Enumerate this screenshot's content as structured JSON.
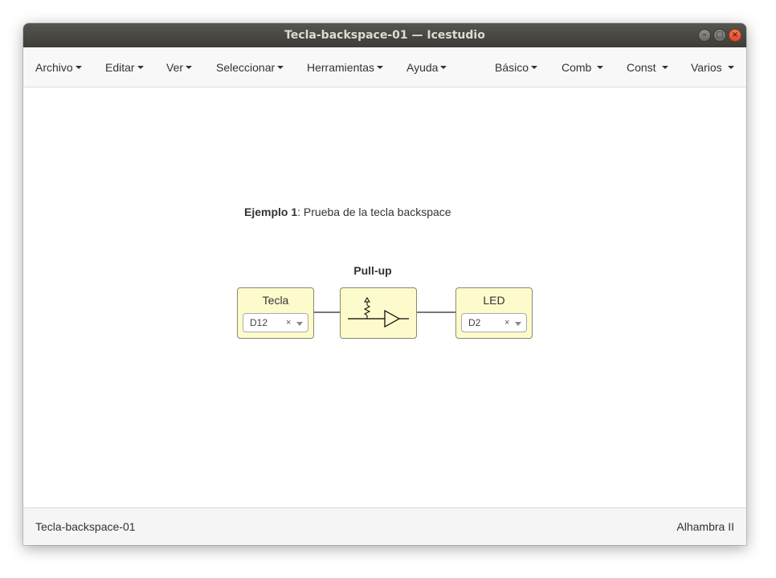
{
  "window": {
    "title": "Tecla-backspace-01 — Icestudio",
    "controls": {
      "minimize_icon": "minimize-icon",
      "maximize_icon": "maximize-icon",
      "close_icon": "close-icon"
    }
  },
  "menubar": {
    "items": [
      {
        "label": "Archivo"
      },
      {
        "label": "Editar"
      },
      {
        "label": "Ver"
      },
      {
        "label": "Seleccionar"
      },
      {
        "label": "Herramientas"
      },
      {
        "label": "Ayuda"
      },
      {
        "label": "Básico"
      },
      {
        "label": "Comb"
      },
      {
        "label": "Const"
      },
      {
        "label": "Varios"
      }
    ]
  },
  "canvas": {
    "note": {
      "bold": "Ejemplo 1",
      "text": ": Prueba de la tecla backspace"
    },
    "pullup_label": "Pull-up",
    "input_block": {
      "title": "Tecla",
      "pin": "D12",
      "clear": "×"
    },
    "output_block": {
      "title": "LED",
      "pin": "D2",
      "clear": "×"
    },
    "pullup_icon": "pullup-resistor-buffer-icon"
  },
  "statusbar": {
    "project": "Tecla-backspace-01",
    "board": "Alhambra II"
  },
  "colors": {
    "block_fill": "#fdfbcc",
    "titlebar": "#3d3c38",
    "close_button": "#e0492b"
  }
}
